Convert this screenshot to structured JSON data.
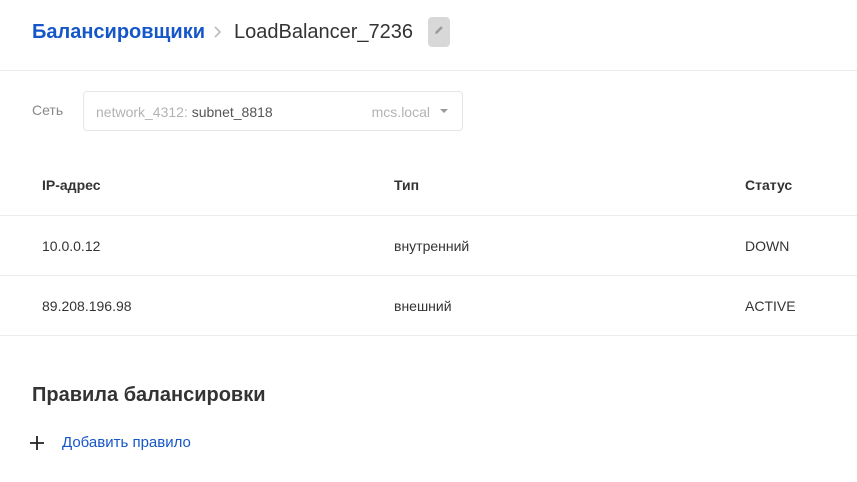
{
  "breadcrumb": {
    "parent": "Балансировщики",
    "current": "LoadBalancer_7236"
  },
  "network": {
    "label": "Сеть",
    "network_name": "network_4312:",
    "subnet_name": "subnet_8818",
    "domain": "mcs.local"
  },
  "table": {
    "headers": [
      "IP-адрес",
      "Тип",
      "Статус"
    ],
    "rows": [
      {
        "ip": "10.0.0.12",
        "type": "внутренний",
        "status": "DOWN"
      },
      {
        "ip": "89.208.196.98",
        "type": "внешний",
        "status": "ACTIVE"
      }
    ]
  },
  "rules": {
    "title": "Правила балансировки",
    "add_label": "Добавить правило"
  },
  "colors": {
    "link": "#1556c9",
    "text": "#333333",
    "muted": "#888888"
  },
  "icons": [
    "chevron-right-icon",
    "pencil-icon",
    "caret-down-icon",
    "plus-icon"
  ]
}
